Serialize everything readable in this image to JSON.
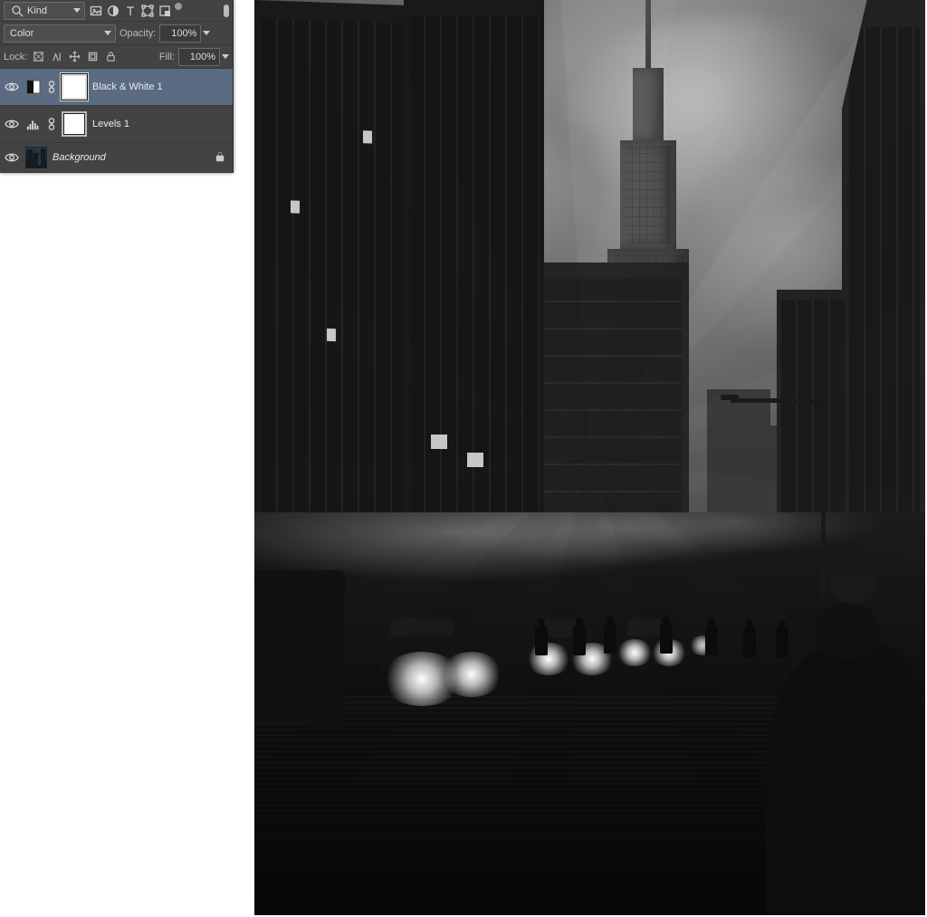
{
  "panel": {
    "filter": {
      "search_icon": "search-icon",
      "kind_label": "Kind",
      "type_icons": [
        "image-icon",
        "adjust-icon",
        "type-icon",
        "shape-icon",
        "smartobj-icon",
        "artboard-icon"
      ]
    },
    "blend": {
      "mode": "Color",
      "opacity_label": "Opacity:",
      "opacity_value": "100%"
    },
    "lock": {
      "label": "Lock:",
      "icons": [
        "lock-transparent-icon",
        "lock-image-icon",
        "lock-position-icon",
        "lock-artboard-icon",
        "lock-all-icon"
      ],
      "fill_label": "Fill:",
      "fill_value": "100%"
    },
    "layers": [
      {
        "visible": true,
        "adjust_icon": "bw-adjust-icon",
        "linked": true,
        "has_mask": true,
        "name": "Black & White 1",
        "selected": true,
        "locked": false
      },
      {
        "visible": true,
        "adjust_icon": "levels-adjust-icon",
        "linked": true,
        "has_mask": true,
        "name": "Levels 1",
        "selected": false,
        "locked": false
      },
      {
        "visible": true,
        "adjust_icon": null,
        "linked": false,
        "has_mask": false,
        "name": "Background",
        "italic": true,
        "selected": false,
        "locked": true
      }
    ]
  },
  "image": {
    "description": "Black-and-white city street scene with tall buildings, Empire State Building in background, wet road with car headlights, pedestrians crossing, overcast cloudy sky, street lamp, and a figure in foreground at bottom right.",
    "filter_applied": "Black & White"
  }
}
